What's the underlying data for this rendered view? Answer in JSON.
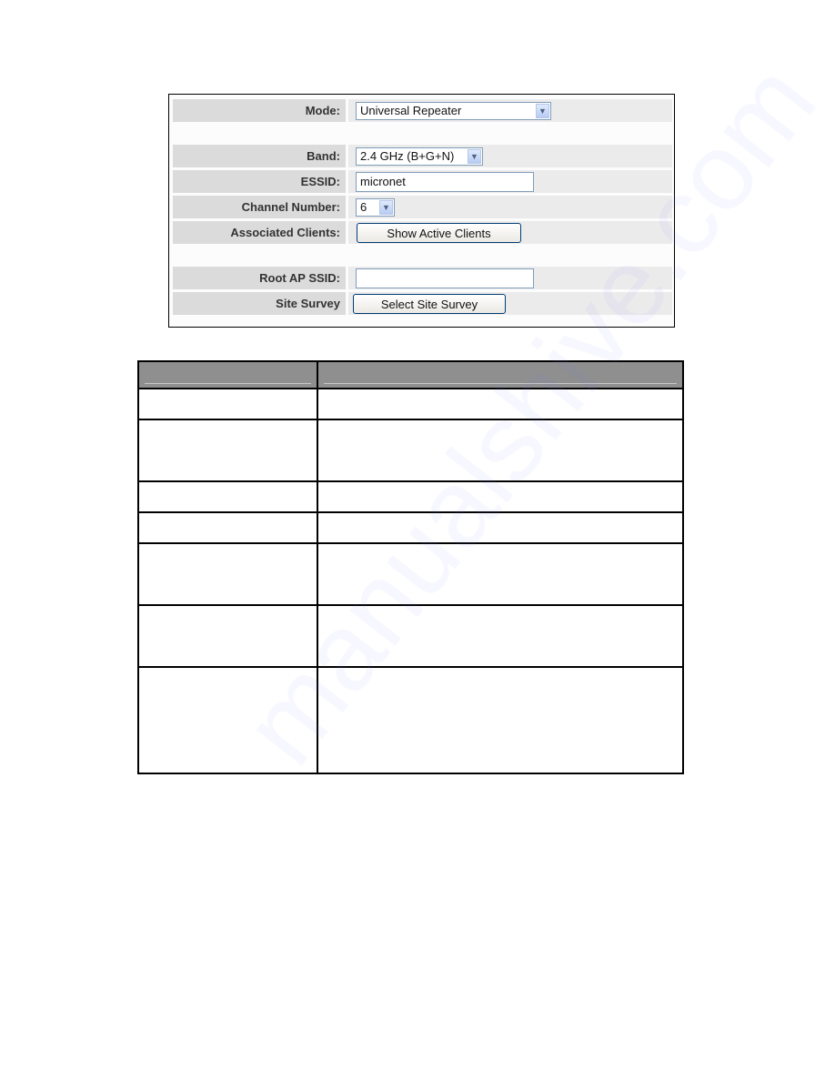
{
  "form": {
    "mode": {
      "label": "Mode:",
      "value": "Universal Repeater"
    },
    "band": {
      "label": "Band:",
      "value": "2.4 GHz (B+G+N)"
    },
    "essid": {
      "label": "ESSID:",
      "value": "micronet"
    },
    "channel": {
      "label": "Channel Number:",
      "value": "6"
    },
    "clients": {
      "label": "Associated Clients:",
      "button": "Show Active Clients"
    },
    "root_ssid": {
      "label": "Root AP SSID:",
      "value": ""
    },
    "site_survey": {
      "label": "Site Survey",
      "button": "Select Site Survey"
    }
  },
  "description_table": {
    "headers": [
      "",
      ""
    ],
    "rows": [
      [
        "",
        ""
      ],
      [
        "",
        ""
      ],
      [
        "",
        ""
      ],
      [
        "",
        ""
      ],
      [
        "",
        ""
      ],
      [
        "",
        ""
      ],
      [
        "",
        ""
      ]
    ]
  },
  "icons": {
    "dropdown": "chevron-down-icon"
  },
  "watermark": "manualshive.com",
  "colors": {
    "label_bg": "#dcdbdc",
    "value_bg": "#ecebec",
    "table_header": "#8f8f8f",
    "input_border": "#7f9db9"
  }
}
